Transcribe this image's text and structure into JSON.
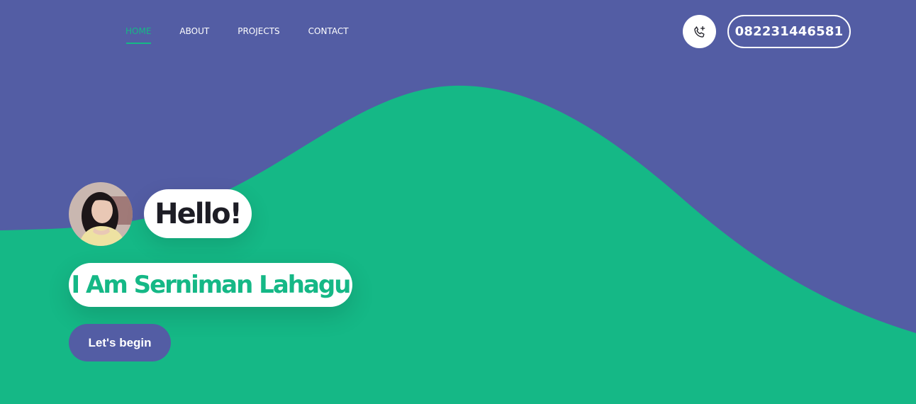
{
  "colors": {
    "background": "#535da4",
    "accent": "#15b886",
    "dark_text": "#1d1d25",
    "white": "#ffffff"
  },
  "nav": {
    "items": [
      {
        "label": "HOME",
        "active": true
      },
      {
        "label": "ABOUT",
        "active": false
      },
      {
        "label": "PROJECTS",
        "active": false
      },
      {
        "label": "CONTACT",
        "active": false
      }
    ]
  },
  "contact": {
    "phone_icon": "phone-plus-icon",
    "phone_number": "08223144658​1"
  },
  "hero": {
    "avatar_icon": "avatar-photo",
    "greeting": "Hello!",
    "intro": "I Am Serniman Lahagu",
    "cta_label": "Let's begin"
  }
}
